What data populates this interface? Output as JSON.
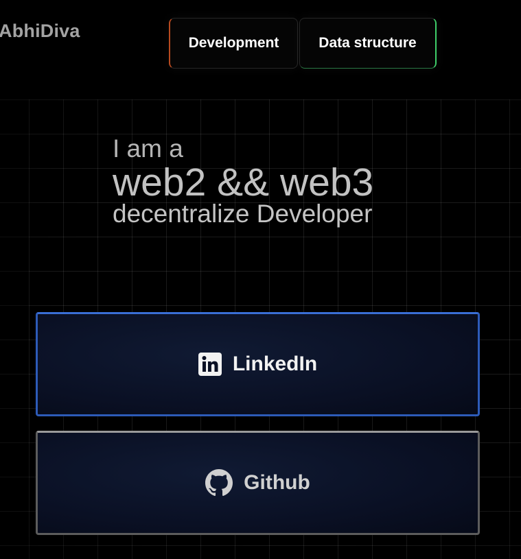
{
  "brand": "AbhiDiva",
  "nav": {
    "development": "Development",
    "data_structure": "Data structure"
  },
  "hero": {
    "line1": "I am a",
    "line2": "web2 && web3",
    "line3": "decentralize Developer"
  },
  "links": {
    "linkedin": {
      "label": "LinkedIn",
      "icon": "linkedin-icon"
    },
    "github": {
      "label": "Github",
      "icon": "github-icon"
    }
  },
  "colors": {
    "background": "#000000",
    "linkedin_border": "#2d5bb8",
    "github_border": "#7a7a7a",
    "development_accent": "#b84a1f",
    "data_structure_accent": "#3fcf6a"
  }
}
